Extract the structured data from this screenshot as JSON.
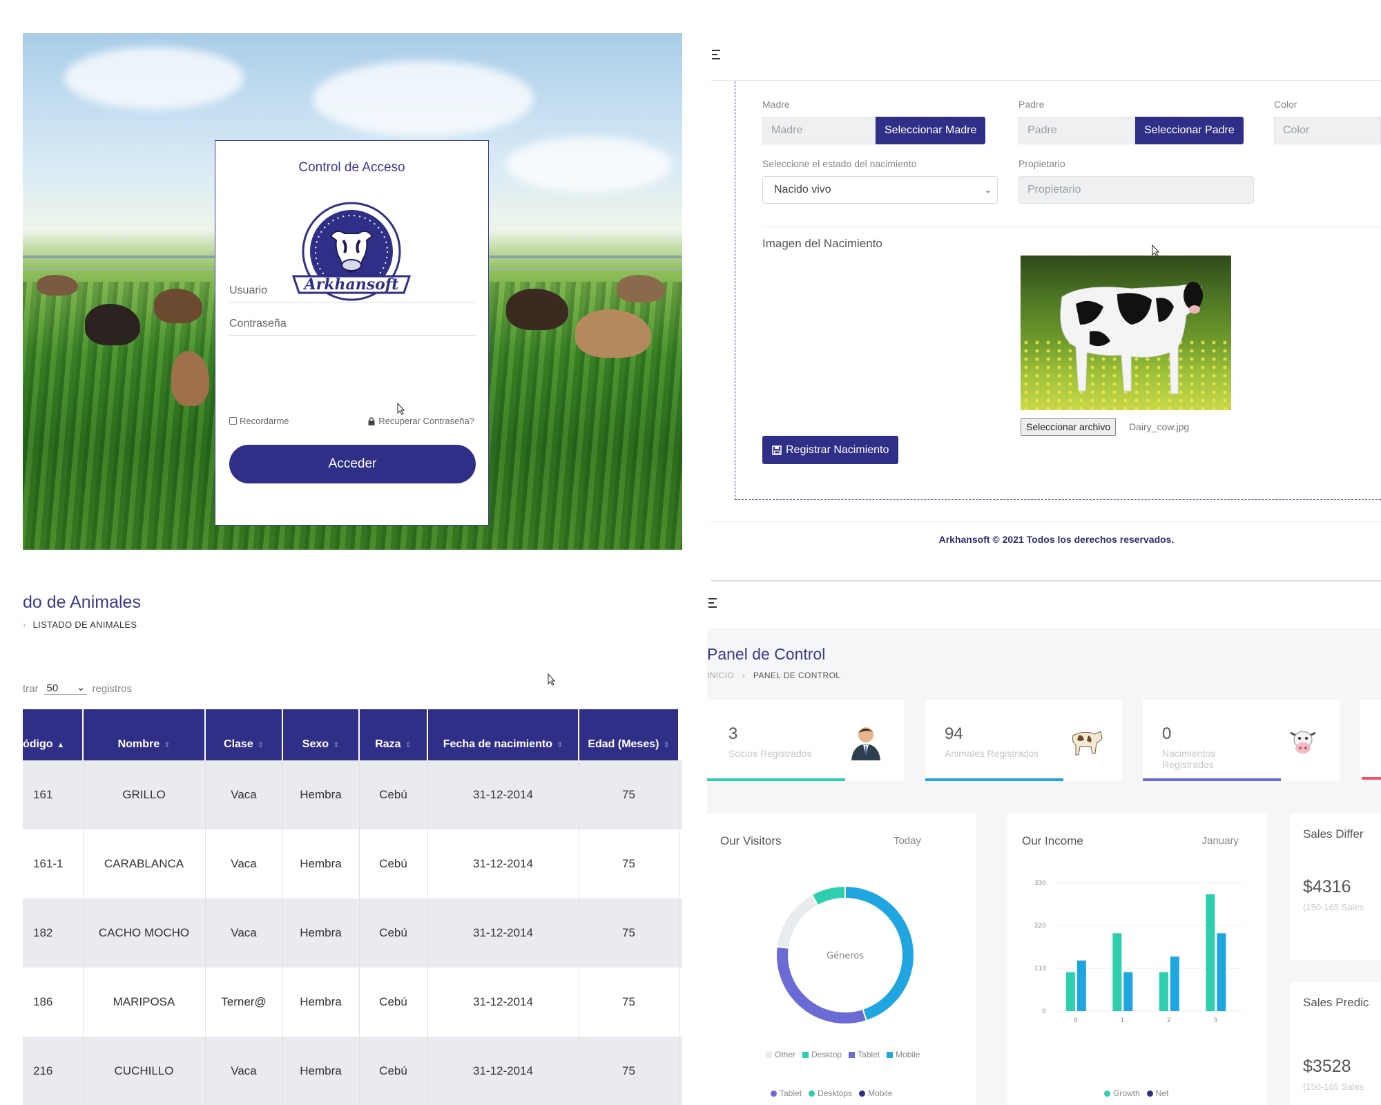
{
  "login": {
    "title": "Control de Acceso",
    "logo_text": "Arkhansoft",
    "username_placeholder": "Usuario",
    "password_placeholder": "Contraseña",
    "remember_label": "Recordarme",
    "recover_label": "Recuperar Contraseña?",
    "submit_label": "Acceder"
  },
  "birth_form": {
    "madre_label": "Madre",
    "madre_placeholder": "Madre",
    "madre_button": "Seleccionar Madre",
    "padre_label": "Padre",
    "padre_placeholder": "Padre",
    "padre_button": "Seleccionar Padre",
    "color_label": "Color",
    "color_placeholder": "Color",
    "estado_label": "Seleccione el estado del nacimiento",
    "estado_value": "Nacido vivo",
    "propietario_label": "Propietario",
    "propietario_placeholder": "Propietario",
    "imagen_label": "Imagen del Nacimiento",
    "file_button": "Seleccionar archivo",
    "file_name": "Dairy_cow.jpg",
    "submit_label": "Registrar Nacimiento",
    "footer": "Arkhansoft © 2021 Todos los derechos reservados."
  },
  "listado": {
    "title": "do de Animales",
    "breadcrumb": "LISTADO DE ANIMALES",
    "show_prefix": "trar",
    "show_value": "50",
    "show_suffix": "registros",
    "columns": [
      "ódigo",
      "Nombre",
      "Clase",
      "Sexo",
      "Raza",
      "Fecha de nacimiento",
      "Edad (Meses)"
    ],
    "rows": [
      [
        "161",
        "GRILLO",
        "Vaca",
        "Hembra",
        "Cebú",
        "31-12-2014",
        "75"
      ],
      [
        "161-1",
        "CARABLANCA",
        "Vaca",
        "Hembra",
        "Cebú",
        "31-12-2014",
        "75"
      ],
      [
        "182",
        "CACHO MOCHO",
        "Vaca",
        "Hembra",
        "Cebú",
        "31-12-2014",
        "75"
      ],
      [
        "186",
        "MARIPOSA",
        "Terner@",
        "Hembra",
        "Cebú",
        "31-12-2014",
        "75"
      ],
      [
        "216",
        "CUCHILLO",
        "Vaca",
        "Hembra",
        "Cebú",
        "31-12-2014",
        "75"
      ]
    ]
  },
  "dashboard": {
    "title": "Panel de Control",
    "breadcrumb_home": "INICIO",
    "breadcrumb_current": "PANEL DE CONTROL",
    "stats": [
      {
        "value": "3",
        "label": "Socios Registrados",
        "progress": 0.7,
        "color": "#2ecfae"
      },
      {
        "value": "94",
        "label": "Animales Registrados",
        "progress": 0.7,
        "color": "#1fa6e0"
      },
      {
        "value": "0",
        "label": "Nacimientos Registrados",
        "progress": 0.7,
        "color": "#6b6bd6"
      }
    ],
    "visitors": {
      "title": "Our Visitors",
      "period": "Today",
      "center_label": "Géneros",
      "legend1": [
        "Other",
        "Desktop",
        "Tablet",
        "Mobile"
      ],
      "legend2": [
        "Tablet",
        "Desktops",
        "Mobile"
      ]
    },
    "income": {
      "title": "Our Income",
      "period": "January",
      "legend": [
        "Growth",
        "Net"
      ]
    },
    "sales_diff": {
      "title": "Sales Differ",
      "value": "$4316",
      "sub": "(150-165 Sales"
    },
    "sales_pred": {
      "title": "Sales Predic",
      "value": "$3528",
      "sub": "(150-165 Sales"
    }
  },
  "chart_data": [
    {
      "type": "pie",
      "title": "Géneros",
      "categories": [
        "Other",
        "Desktop",
        "Tablet",
        "Mobile"
      ],
      "values": [
        15,
        8,
        32,
        45
      ],
      "colors": [
        "#e8ecef",
        "#2ecfae",
        "#6b6bd6",
        "#1fa6e0"
      ]
    },
    {
      "type": "bar",
      "categories": [
        "0",
        "1",
        "2",
        "3"
      ],
      "series": [
        {
          "name": "Growth",
          "values": [
            100,
            200,
            100,
            300
          ],
          "color": "#2ecfae"
        },
        {
          "name": "Net",
          "values": [
            130,
            100,
            140,
            200
          ],
          "color": "#1fa6e0"
        }
      ],
      "yticks": [
        "0",
        "110",
        "220",
        "330"
      ],
      "ylim": [
        0,
        330
      ]
    }
  ]
}
